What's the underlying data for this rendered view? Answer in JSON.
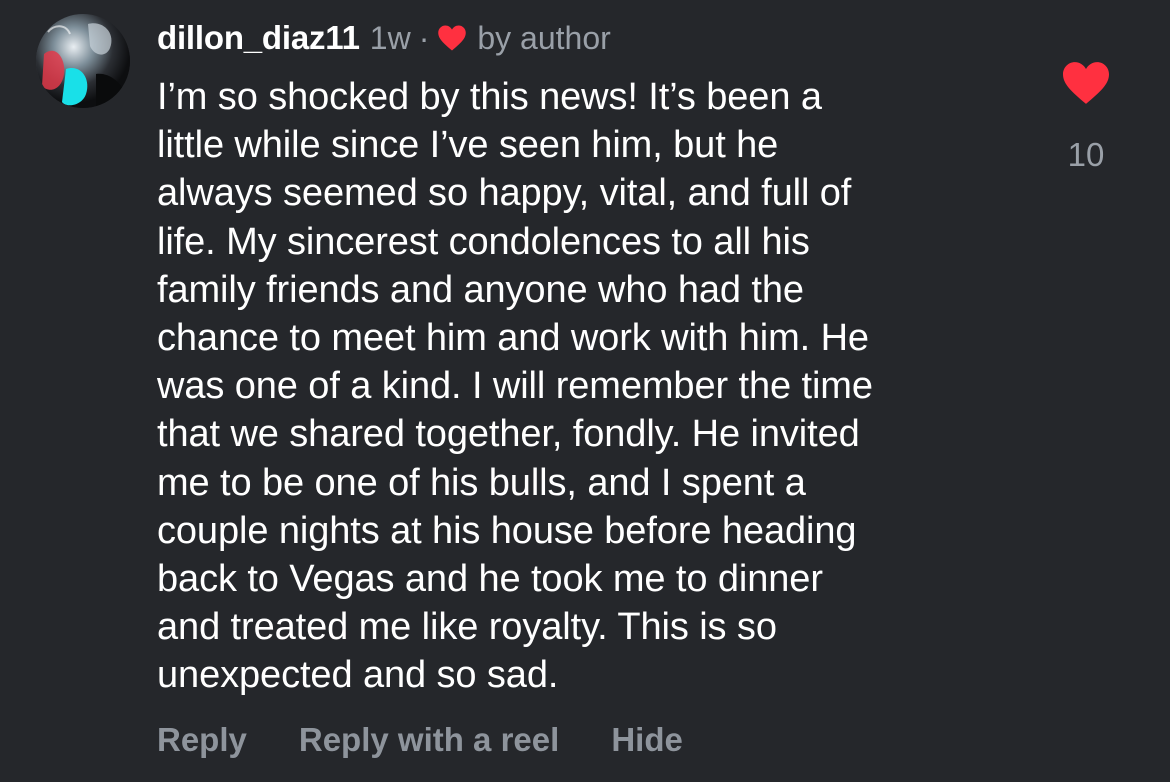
{
  "comment": {
    "username": "dillon_diaz11",
    "time_ago": "1w",
    "separator": "·",
    "author_badge_text": "by author",
    "text": "I’m so shocked by this news! It’s been a\nlittle while since I’ve seen him, but he\nalways seemed so happy, vital, and full of\nlife.  My sincerest condolences to all his\nfamily friends and anyone who had the\nchance to meet him and work with him. He\nwas one of a kind. I will remember the time\nthat we shared together, fondly.  He invited\nme to be one of his bulls, and I spent a\ncouple nights at his house before heading\nback to Vegas and he took me to dinner\nand treated me like royalty.  This is so\nunexpected and so sad.",
    "like_count": "10"
  },
  "actions": {
    "reply": "Reply",
    "reply_with_reel": "Reply with a reel",
    "hide": "Hide"
  },
  "icons": {
    "like": "heart-filled-icon",
    "author_like": "heart-filled-icon"
  },
  "colors": {
    "background": "#25272b",
    "heart": "#ff3040",
    "secondary_text": "#9aa0a8"
  }
}
